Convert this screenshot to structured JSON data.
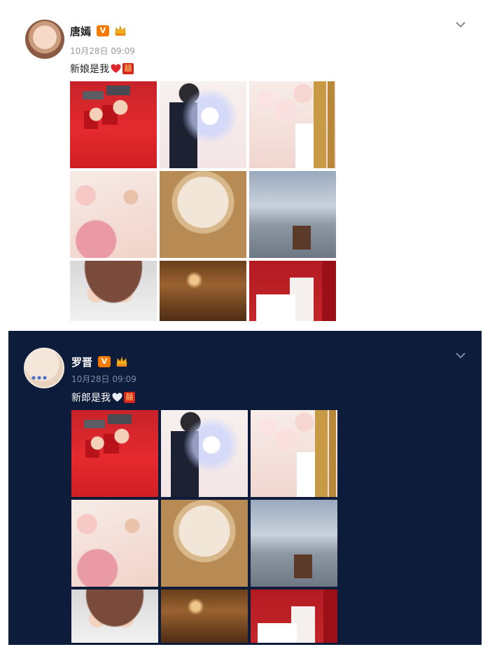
{
  "posts": [
    {
      "theme": "light",
      "username": "唐嫣",
      "verified_badge": "V",
      "time": "10月28日 09:09",
      "text": "新娘是我",
      "icons": [
        "heart-icon-red",
        "double-happiness-icon"
      ],
      "photos": [
        "photo-1",
        "photo-2",
        "photo-3",
        "photo-4",
        "photo-5",
        "photo-6",
        "photo-7",
        "photo-8",
        "photo-9"
      ]
    },
    {
      "theme": "dark",
      "username": "罗晋",
      "verified_badge": "V",
      "time": "10月28日 09:09",
      "text": "新郎是我",
      "icons": [
        "heart-icon-white",
        "double-happiness-icon"
      ],
      "photos": [
        "photo-1",
        "photo-2",
        "photo-3",
        "photo-4",
        "photo-5",
        "photo-6",
        "photo-7",
        "photo-8",
        "photo-9"
      ]
    }
  ],
  "colors": {
    "dark_background": "#0d1c3a",
    "verified_orange": "#f47a00",
    "heart_red": "#e0262b"
  },
  "double_happiness_char": "囍"
}
